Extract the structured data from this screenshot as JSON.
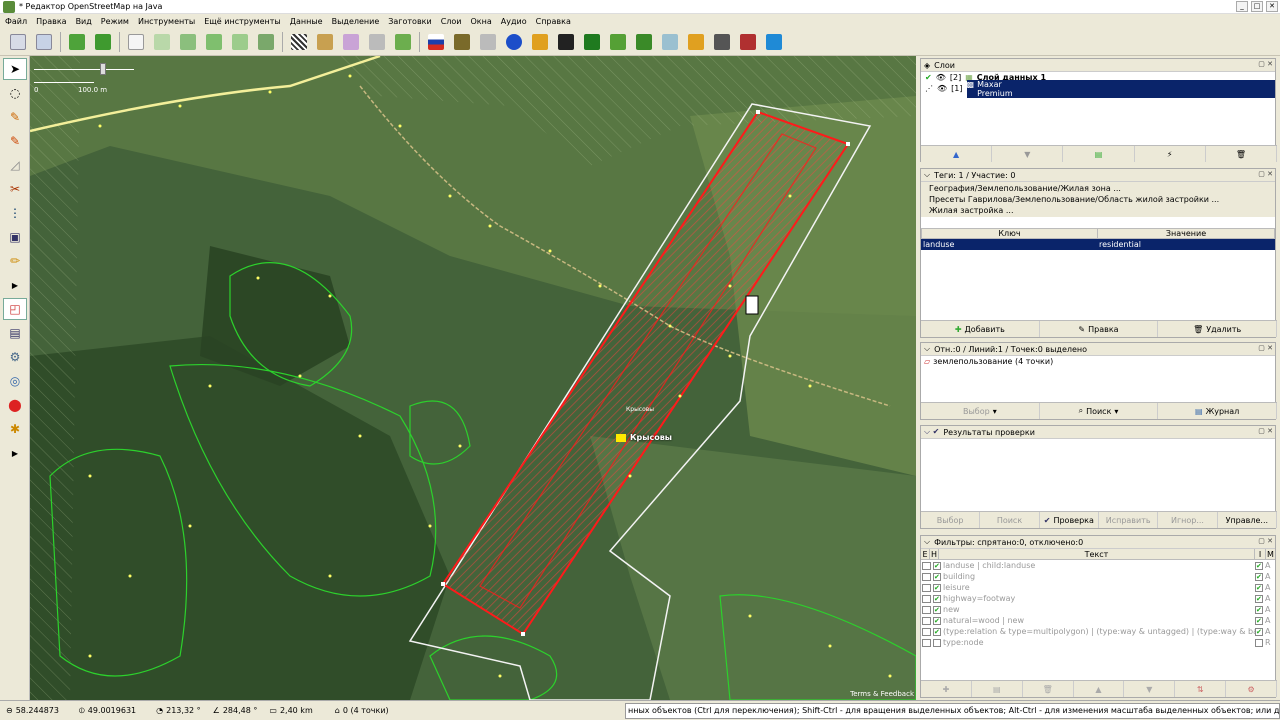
{
  "window": {
    "title": "* Редактор OpenStreetMap на Java"
  },
  "menu": [
    "Файл",
    "Правка",
    "Вид",
    "Режим",
    "Инструменты",
    "Ещё инструменты",
    "Данные",
    "Выделение",
    "Заготовки",
    "Слои",
    "Окна",
    "Аудио",
    "Справка"
  ],
  "map": {
    "scale_zero": "0",
    "scale_label": "100.0 m",
    "village_label": "Крысовы",
    "village_small_label": "Крысовы",
    "attribution": "Terms & Feedback"
  },
  "layers": {
    "header": "Слои",
    "items": [
      {
        "index": "[2]",
        "name": "Слой данных 1",
        "selected": false
      },
      {
        "index": "[1]",
        "name": "Maxar Premium",
        "selected": true
      }
    ]
  },
  "tags": {
    "header": "Теги: 1 / Участие: 0",
    "presets": [
      "География/Землепользование/Жилая зона ...",
      "Пресеты Гаврилова/Землепользование/Область жилой застройки ...",
      "Жилая застройка ..."
    ],
    "col_key": "Ключ",
    "col_value": "Значение",
    "rows": [
      {
        "key": "landuse",
        "value": "residential"
      }
    ],
    "add": "Добавить",
    "edit": "Правка",
    "delete": "Удалить"
  },
  "selection": {
    "header": "Отн.:0 / Линий:1 / Точек:0 выделено",
    "items": [
      "землепользование (4 точки)"
    ],
    "select_btn": "Выбор",
    "search_btn": "Поиск",
    "history_btn": "Журнал"
  },
  "validation": {
    "header": "Результаты проверки",
    "select": "Выбор",
    "search": "Поиск",
    "validate": "Проверка",
    "fix": "Исправить",
    "ignore": "Игнор...",
    "manage": "Управле..."
  },
  "filter": {
    "header": "Фильтры: спрятано:0, отключено:0",
    "col_e": "E",
    "col_h": "H",
    "col_text": "Текст",
    "col_i": "I",
    "col_m": "M",
    "rows": [
      {
        "text": "landuse | child:landuse",
        "m": "A"
      },
      {
        "text": "building",
        "m": "A"
      },
      {
        "text": "leisure",
        "m": "A"
      },
      {
        "text": "highway=footway",
        "m": "A"
      },
      {
        "text": "new",
        "m": "A"
      },
      {
        "text": "natural=wood | new",
        "m": "A"
      },
      {
        "text": "(type:relation & type=multipolygon) | (type:way & untagged) | (type:way & barrier)",
        "m": "A"
      },
      {
        "text": "type:node",
        "m": "R"
      }
    ]
  },
  "status": {
    "lat": "58.244873",
    "lon": "49.0019631",
    "heading": "213,32 °",
    "angle": "284,48 °",
    "distance": "2,40 km",
    "selection_info": "0 (4 точки)",
    "help": "нных объектов (Ctrl для переключения); Shift-Ctrl - для вращения выделенных объектов; Alt-Ctrl - для изменения масштаба выделенных объектов; или для изменения выделения"
  },
  "colors": {
    "selection": "#0a246a",
    "area": "#ff2020",
    "panel": "#ece9d8"
  }
}
